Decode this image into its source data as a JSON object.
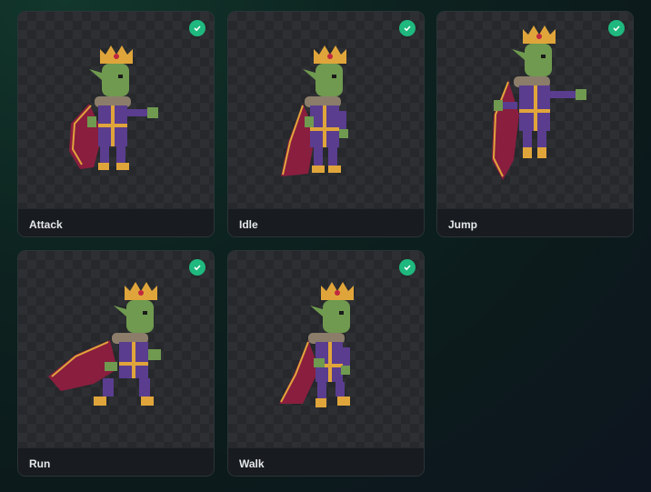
{
  "animations": [
    {
      "label": "Attack",
      "status_icon": "check-circle-icon",
      "status": "complete"
    },
    {
      "label": "Idle",
      "status_icon": "check-circle-icon",
      "status": "complete"
    },
    {
      "label": "Jump",
      "status_icon": "check-circle-icon",
      "status": "complete"
    },
    {
      "label": "Run",
      "status_icon": "check-circle-icon",
      "status": "complete"
    },
    {
      "label": "Walk",
      "status_icon": "check-circle-icon",
      "status": "complete"
    }
  ],
  "colors": {
    "check": "#1fb87e",
    "skin": "#6f9a4f",
    "robe": "#5a3d8f",
    "cape": "#8a1e3e",
    "gold": "#e0a53a",
    "fur": "#8b7d6a"
  }
}
